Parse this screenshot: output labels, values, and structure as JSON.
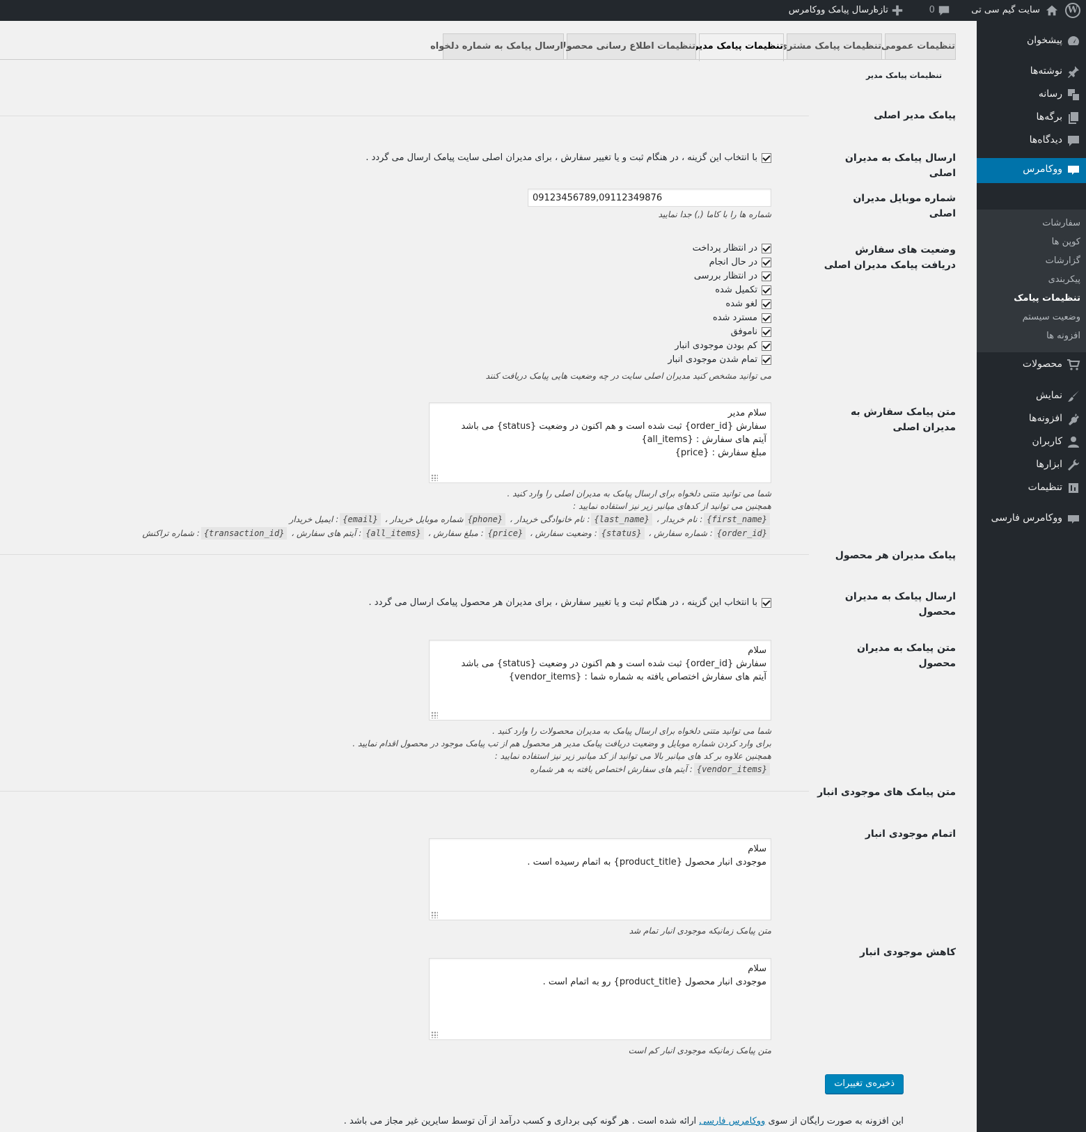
{
  "adminbar": {
    "site_name": "سایت گیم سی تی",
    "comments_count": "0",
    "new_label": "تازه",
    "plugin_link": "ارسال پیامک ووکامرس"
  },
  "sidebar": {
    "items": [
      {
        "label": "پیشخوان",
        "icon": "dashboard-icon"
      },
      {
        "label": "نوشته‌ها",
        "icon": "pin-icon"
      },
      {
        "label": "رسانه",
        "icon": "media-icon"
      },
      {
        "label": "برگه‌ها",
        "icon": "pages-icon"
      },
      {
        "label": "دیدگاه‌ها",
        "icon": "comment-icon"
      },
      {
        "label": "ووکامرس",
        "icon": "woo-icon"
      },
      {
        "label": "محصولات",
        "icon": "cart-icon"
      },
      {
        "label": "نمایش",
        "icon": "brush-icon"
      },
      {
        "label": "افزونه‌ها",
        "icon": "plugin-icon"
      },
      {
        "label": "کاربران",
        "icon": "user-icon"
      },
      {
        "label": "ابزارها",
        "icon": "wrench-icon"
      },
      {
        "label": "تنظیمات",
        "icon": "settings-icon"
      },
      {
        "label": "ووکامرس فارسی",
        "icon": "woo-fa-icon"
      }
    ],
    "submenu": [
      "سفارشات",
      "کوپن ها",
      "گزارشات",
      "پیکربندی",
      "تنظیمات پیامک",
      "وضعیت سیستم",
      "افزونه ها"
    ]
  },
  "tabs": [
    "تنظیمات عمومی",
    "تنظیمات پیامک مشتری",
    "تنظیمات پیامک مدیر",
    "تنظیمات اطلاع رسانی محصولات",
    "ارسال پیامک به شماره دلخواه"
  ],
  "page_heading": "تنظیمات پیامک مدیر",
  "main_admin": {
    "section_title": "پیامک مدیر اصلی",
    "send_label": "ارسال پیامک به مدیران اصلی",
    "send_checkbox_text": "با انتخاب این گزینه ، در هنگام ثبت و یا تغییر سفارش ، برای مدیران اصلی سایت پیامک ارسال می گردد .",
    "mobile_label": "شماره موبایل مدیران اصلی",
    "mobile_value": "09123456789,09112349876",
    "mobile_desc": "شماره ها را با کاما (,) جدا نمایید",
    "status_label": "وضعیت های سفارش دریافت پیامک مدیران اصلی",
    "statuses": [
      "در انتظار پرداخت",
      "در حال انجام",
      "در انتظار بررسی",
      "تکمیل شده",
      "لغو شده",
      "مسترد شده",
      "ناموفق",
      "کم بودن موجودی انبار",
      "تمام شدن موجودی انبار"
    ],
    "status_desc": "می توانید مشخص کنید مدیران اصلی سایت در چه وضعیت هایی پیامک دریافت کنند",
    "text_label": "متن پیامک سفارش به مدیران اصلی",
    "text_value": "سلام مدیر\nسفارش {order_id} ثبت شده است و هم اکنون در وضعیت {status} می باشد\nآیتم های سفارش : {all_items}\nمبلغ سفارش : {price}",
    "text_desc1": "شما می توانید متنی دلخواه برای ارسال پیامک به مدیران اصلی را وارد کنید .",
    "text_desc2": "همچنین می توانید از کدهای میانبر زیر نیز استفاده نمایید :",
    "codes_line1": [
      {
        "code": "{first_name}",
        "text": ": نام خریدار ،"
      },
      {
        "code": "{last_name}",
        "text": ": نام خانوادگی خریدار ،"
      },
      {
        "code": "{phone}",
        "text": "شماره موبایل خریدار ،"
      },
      {
        "code": "{email}",
        "text": ": ایمیل خریدار"
      }
    ],
    "codes_line2": [
      {
        "code": "{order_id}",
        "text": ": شماره سفارش ،"
      },
      {
        "code": "{status}",
        "text": ": وضعیت سفارش ،"
      },
      {
        "code": "{price}",
        "text": ": مبلغ سفارش ،"
      },
      {
        "code": "{all_items}",
        "text": ": آیتم های سفارش ،"
      },
      {
        "code": "{transaction_id}",
        "text": ": شماره تراکنش"
      }
    ]
  },
  "product_admin": {
    "section_title": "پیامک مدیران هر محصول",
    "send_label": "ارسال پیامک به مدیران محصول",
    "send_checkbox_text": "با انتخاب این گزینه ، در هنگام ثبت و یا تغییر سفارش ، برای مدیران هر محصول پیامک ارسال می گردد .",
    "text_label": "متن پیامک به مدیران محصول",
    "text_value": "سلام\nسفارش {order_id} ثبت شده است و هم اکنون در وضعیت {status} می باشد\nآیتم های سفارش اختصاص یافته به شماره شما : {vendor_items}",
    "desc1": "شما می توانید متنی دلخواه برای ارسال پیامک به مدیران محصولات را وارد کنید .",
    "desc2": "برای وارد کردن شماره موبایل و وضعیت دریافت پیامک مدیر هر محصول هم از تب پیامک موجود در محصول اقدام نمایید .",
    "desc3": "همچنین علاوه بر کد های میانبر بالا می توانید از کد میانبر زیر نیز استفاده نمایید :",
    "code": "{vendor_items}",
    "code_text": ": آیتم های سفارش اختصاص یافته به هر شماره"
  },
  "stock": {
    "section_title": "متن پیامک های موجودی انبار",
    "out_label": "اتمام موجودی انبار",
    "out_value": "سلام\nموجودی انبار محصول {product_title} به اتمام رسیده است .",
    "out_desc": "متن پیامک زمانیکه موجودی انبار تمام شد",
    "low_label": "کاهش موجودی انبار",
    "low_value": "سلام\nموجودی انبار محصول {product_title} رو به اتمام است .",
    "low_desc": "متن پیامک زمانیکه موجودی انبار کم است"
  },
  "save_label": "ذخیره‌ی تغییرات",
  "footer": {
    "before": "این افزونه به صورت رایگان از سوی",
    "link": "ووکامرس فارسی",
    "after": "ارائه شده است . هر گونه کپی برداری و کسب درآمد از آن توسط سایرین غیر مجاز می باشد ."
  },
  "colors": {
    "accent": "#0073aa",
    "sidebar": "#23282d",
    "button": "#0085ba"
  }
}
